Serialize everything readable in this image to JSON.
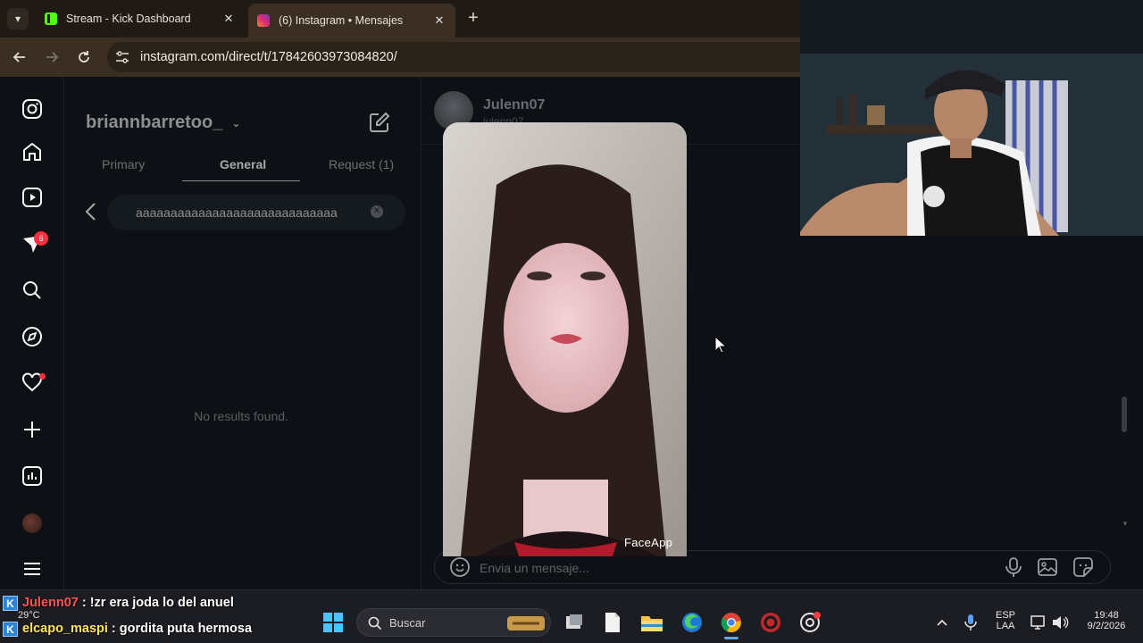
{
  "browser": {
    "tabs": [
      {
        "title": "Stream - Kick Dashboard",
        "active": false,
        "favicon": "kick-icon"
      },
      {
        "title": "(6) Instagram • Mensajes",
        "active": true,
        "favicon": "instagram-icon"
      }
    ],
    "close_glyph": "✕",
    "new_tab_glyph": "+",
    "url": "instagram.com/direct/t/17842603973084820/"
  },
  "instagram": {
    "rail": {
      "icons": [
        "instagram-logo-icon",
        "home-icon",
        "reels-icon",
        "messenger-icon",
        "search-icon",
        "explore-icon",
        "heart-icon",
        "create-icon",
        "insights-icon",
        "profile-icon",
        "menu-icon"
      ],
      "messages_badge": "6"
    },
    "inbox": {
      "account": "briannbarretoo_",
      "tabs": [
        {
          "label": "Primary",
          "selected": false
        },
        {
          "label": "General",
          "selected": true
        },
        {
          "label": "Request (1)",
          "selected": false
        }
      ],
      "search_value": "aaaaaaaaaaaaaaaaaaaaaaaaaaaaa",
      "empty_text": "No results found."
    },
    "chat": {
      "name": "Julenn07",
      "handle": "julenn07",
      "message_placeholder": "Envia un mensaje...",
      "photo_label": "FaceApp"
    }
  },
  "taskbar": {
    "weather": "29°C",
    "search_placeholder": "Buscar",
    "language_top": "ESP",
    "language_bottom": "LAA",
    "time": "19:48",
    "date": "9/2/2026",
    "apps": [
      "start-icon",
      "widgets-icon",
      "task-view-icon",
      "notepad-icon",
      "file-explorer-icon",
      "edge-icon",
      "chrome-icon",
      "obs-icon",
      "app-icon"
    ]
  },
  "stream_chat": [
    {
      "user": "Julenn07",
      "message": ": !zr era joda lo del anuel"
    },
    {
      "user": "elcapo_maspi",
      "message": ": gordita puta hermosa"
    }
  ],
  "colors": {
    "ig_bg": "#0d1014",
    "browser_frame": "#3a2f22",
    "taskbar": "#1c1d22",
    "accent_red": "#ff3040"
  }
}
